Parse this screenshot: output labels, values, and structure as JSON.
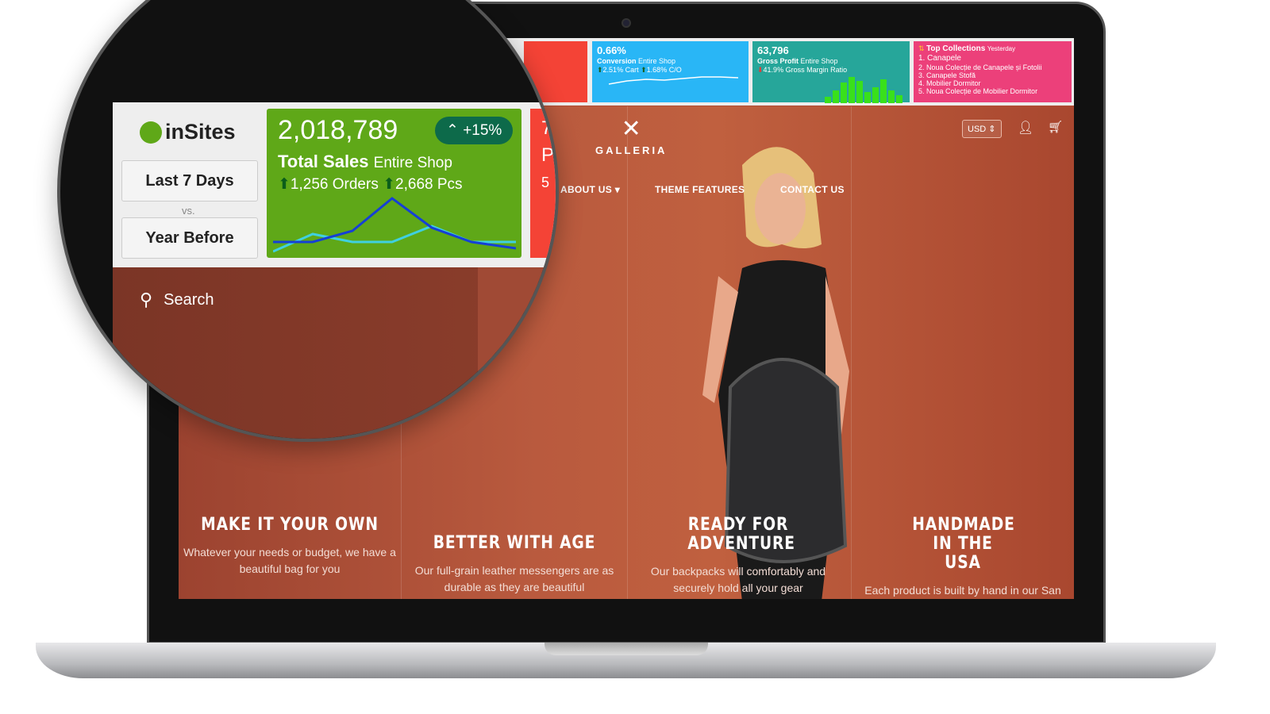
{
  "dashboard": {
    "conversion": {
      "value": "0.66%",
      "title": "Conversion",
      "scope": "Entire Shop",
      "cart": "2.51%",
      "cart_label": "Cart",
      "co": "1.68%",
      "co_label": "C/O",
      "color": "#29b6f6"
    },
    "gross_profit": {
      "value": "63,796",
      "title": "Gross Profit",
      "scope": "Entire Shop",
      "ratio": "41.9%",
      "ratio_label": "Gross Margin Ratio",
      "color": "#26a69a"
    },
    "top_collections": {
      "title": "Top Collections",
      "period": "Yesterday",
      "items": [
        "1. Canapele",
        "2. Noua Colecție de Canapele și Fotolii",
        "3. Canapele Stofă",
        "4. Mobilier Dormitor",
        "5. Noua Colecție de Mobilier Dormitor"
      ],
      "color": "#ec407a"
    },
    "partial_card": {
      "value": "7",
      "title": "P",
      "sub": "5"
    }
  },
  "insites": {
    "logo": "inSites",
    "range": "Last 7 Days",
    "vs": "vs.",
    "compare": "Year Before",
    "total_sales": {
      "value": "2,018,789",
      "change": "+15%",
      "title": "Total Sales",
      "scope": "Entire Shop",
      "orders": "1,256",
      "orders_label": "Orders",
      "pcs": "2,668",
      "pcs_label": "Pcs",
      "color": "#5fa818"
    }
  },
  "store": {
    "brand": "GALLERIA",
    "currency": "USD",
    "search": "Search",
    "nav": [
      "ABOUT US",
      "THEME FEATURES",
      "CONTACT US"
    ],
    "features": [
      {
        "title": "MAKE IT YOUR OWN",
        "text": "Whatever your needs or budget, we have a beautiful bag for you"
      },
      {
        "title": "BETTER WITH AGE",
        "text": "Our full-grain leather messengers are as durable as they are beautiful"
      },
      {
        "title": "READY FOR ADVENTURE",
        "text": "Our backpacks will comfortably and securely hold all your gear"
      },
      {
        "title": "HANDMADE IN THE USA",
        "text": "Each product is built by hand in our San Francisco sewing shop"
      }
    ]
  }
}
